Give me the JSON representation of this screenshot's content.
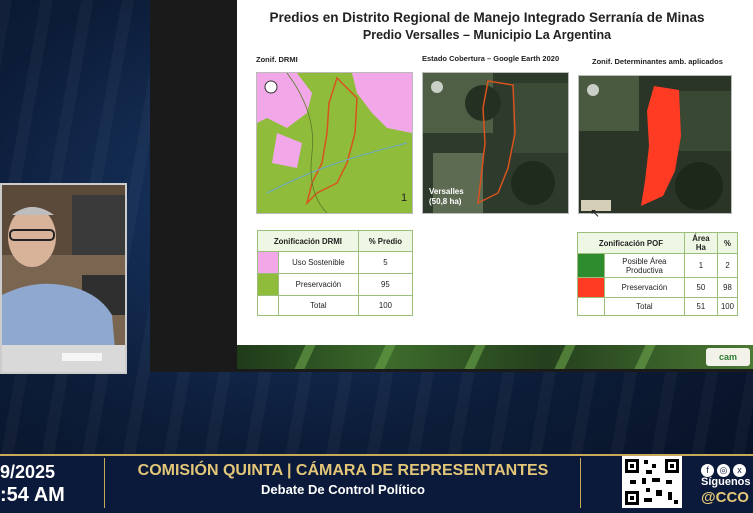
{
  "slide": {
    "title_line1": "Predios en Distrito Regional de Manejo Integrado Serranía de Minas",
    "title_line2": "Predio Versalles – Municipio La Argentina",
    "map_captions": [
      "Zonif. DRMI",
      "Estado Cobertura – Google Earth 2020",
      "Zonif. Determinantes amb. aplicados"
    ],
    "map1_number": "1",
    "map2_label_line1": "Versalles",
    "map2_label_line2": "(50,8 ha)",
    "logo_text": "cam"
  },
  "table_drmi": {
    "headers": [
      "Zonificación DRMI",
      "% Predio"
    ],
    "rows": [
      {
        "label": "Uso Sostenible",
        "value": "5",
        "swatch": "#f2a8e8"
      },
      {
        "label": "Preservación",
        "value": "95",
        "swatch": "#8fbc3a"
      },
      {
        "label": "Total",
        "value": "100",
        "swatch": ""
      }
    ]
  },
  "table_pof": {
    "headers": [
      "Zonificación POF",
      "Área Ha",
      "%"
    ],
    "rows": [
      {
        "label": "Posible Área Productiva",
        "ha": "1",
        "pct": "2",
        "swatch": "#2e8b2e"
      },
      {
        "label": "Preservación",
        "ha": "50",
        "pct": "98",
        "swatch": "#ff3b24"
      },
      {
        "label": "Total",
        "ha": "51",
        "pct": "100",
        "swatch": ""
      }
    ]
  },
  "ticker": {
    "date": "9/2025",
    "time": ":54 AM",
    "title": "COMISIÓN QUINTA | CÁMARA DE REPRESENTANTES",
    "subtitle": "Debate De Control Político",
    "follow": "Síguenos",
    "handle": "@CCO"
  }
}
